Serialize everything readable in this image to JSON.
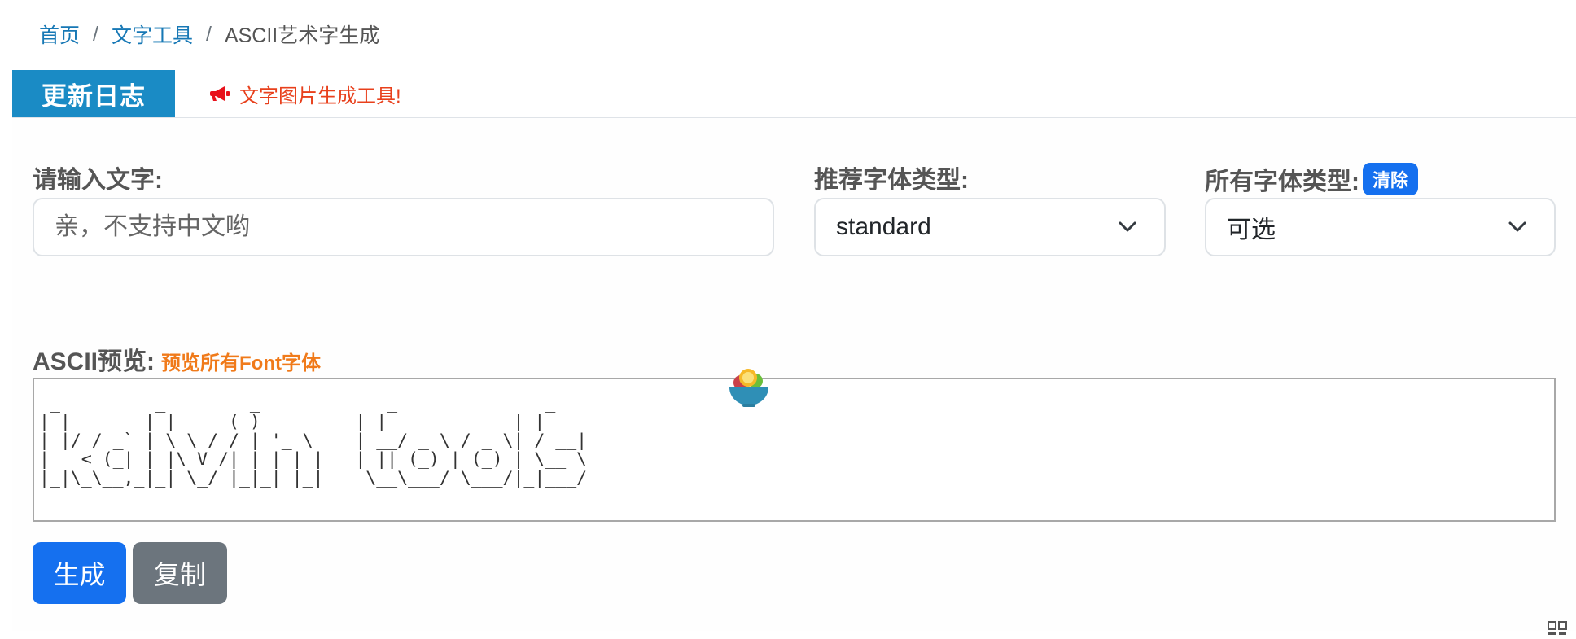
{
  "breadcrumb": {
    "home": "首页",
    "category": "文字工具",
    "current": "ASCII艺术字生成",
    "separator": "/"
  },
  "notice": {
    "tag": "更新日志",
    "message": "文字图片生成工具!",
    "icon": "megaphone-icon"
  },
  "form": {
    "text_label": "请输入文字:",
    "text_placeholder": "亲，不支持中文哟",
    "recommended_label": "推荐字体类型:",
    "recommended_value": "standard",
    "all_fonts_label": "所有字体类型:",
    "clear_badge": "清除",
    "all_fonts_value": "可选"
  },
  "preview": {
    "label": "ASCII预览:",
    "link": "预览所有Font字体",
    "ascii": " _         _        _            _              _      \n| | ____ _| |_   _(_)_ __     | |_ ___   ___ | |___ \n| |/ / _` | \\ \\ / / | '_ \\    | __/ _ \\ / _ \\| / __|\n|   < (_| | |\\ V /| | | | |   | || (_) | (_) | \\__ \\\n|_|\\_\\__,_|_| \\_/ |_|_| |_|    \\__\\___/ \\___/|_|___/"
  },
  "buttons": {
    "generate": "生成",
    "copy": "复制"
  },
  "colors": {
    "accent": "#1a8bc5",
    "primary": "#1570ef",
    "secondary": "#6c757d",
    "notice_text": "#e8401c",
    "link_orange": "#f07a1a"
  }
}
